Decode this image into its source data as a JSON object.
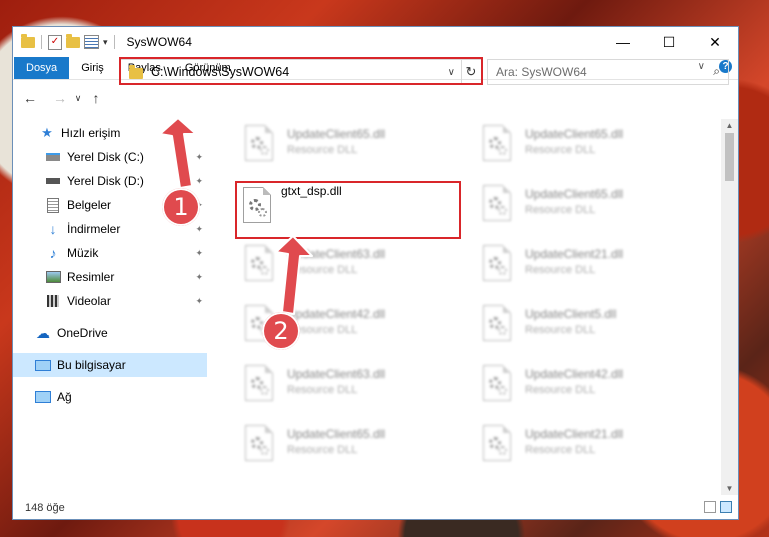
{
  "window": {
    "title": "SysWOW64",
    "minimize_label": "—",
    "maximize_label": "☐",
    "close_label": "✕"
  },
  "ribbon": {
    "tabs": [
      {
        "label": "Dosya"
      },
      {
        "label": "Giriş"
      },
      {
        "label": "Paylaş"
      },
      {
        "label": "Görünüm"
      }
    ],
    "expand_label": "∨",
    "help_label": "?"
  },
  "address": {
    "path": "C:\\Windows\\SysWOW64",
    "dropdown_label": "∨",
    "refresh_label": "↻"
  },
  "search": {
    "placeholder": "Ara: SysWOW64",
    "icon_label": "⌕"
  },
  "nav_buttons": {
    "back": "←",
    "forward": "→",
    "recent": "∨",
    "up": "↑"
  },
  "sidebar": {
    "items": [
      {
        "label": "Hızlı erişim",
        "icon": "star-icon"
      },
      {
        "label": "Yerel Disk (C:)",
        "icon": "drive-icon",
        "pinned": true
      },
      {
        "label": "Yerel Disk (D:)",
        "icon": "drive-icon",
        "pinned": true
      },
      {
        "label": "Belgeler",
        "icon": "document-icon",
        "pinned": true
      },
      {
        "label": "İndirmeler",
        "icon": "download-icon",
        "pinned": true
      },
      {
        "label": "Müzik",
        "icon": "music-icon",
        "pinned": true
      },
      {
        "label": "Resimler",
        "icon": "pictures-icon",
        "pinned": true
      },
      {
        "label": "Videolar",
        "icon": "video-icon",
        "pinned": true
      },
      {
        "label": "OneDrive",
        "icon": "cloud-icon"
      },
      {
        "label": "Bu bilgisayar",
        "icon": "computer-icon",
        "selected": true
      },
      {
        "label": "Ağ",
        "icon": "network-icon"
      }
    ],
    "pin_glyph": "📌"
  },
  "files": {
    "selected": {
      "name": "gtxt_dsp.dll"
    },
    "blurred": [
      {
        "name": "UpdateClient65.dll",
        "type": "Resource DLL"
      },
      {
        "name": "UpdateClient65.dll",
        "type": "Resource DLL"
      },
      {
        "name": "UpdateClient65.dll",
        "type": "Resource DLL"
      },
      {
        "name": "UpdateClient63.dll",
        "type": "Resource DLL"
      },
      {
        "name": "UpdateClient21.dll",
        "type": "Resource DLL"
      },
      {
        "name": "UpdateClient42.dll",
        "type": "Resource DLL"
      },
      {
        "name": "UpdateClient5.dll",
        "type": "Resource DLL"
      },
      {
        "name": "UpdateClient63.dll",
        "type": "Resource DLL"
      },
      {
        "name": "UpdateClient42.dll",
        "type": "Resource DLL"
      },
      {
        "name": "UpdateClient65.dll",
        "type": "Resource DLL"
      },
      {
        "name": "UpdateClient21.dll",
        "type": "Resource DLL"
      }
    ]
  },
  "status": {
    "count": "148 öğe"
  },
  "annotations": {
    "marker1": "1",
    "marker2": "2",
    "highlight_color": "#d9262a"
  }
}
